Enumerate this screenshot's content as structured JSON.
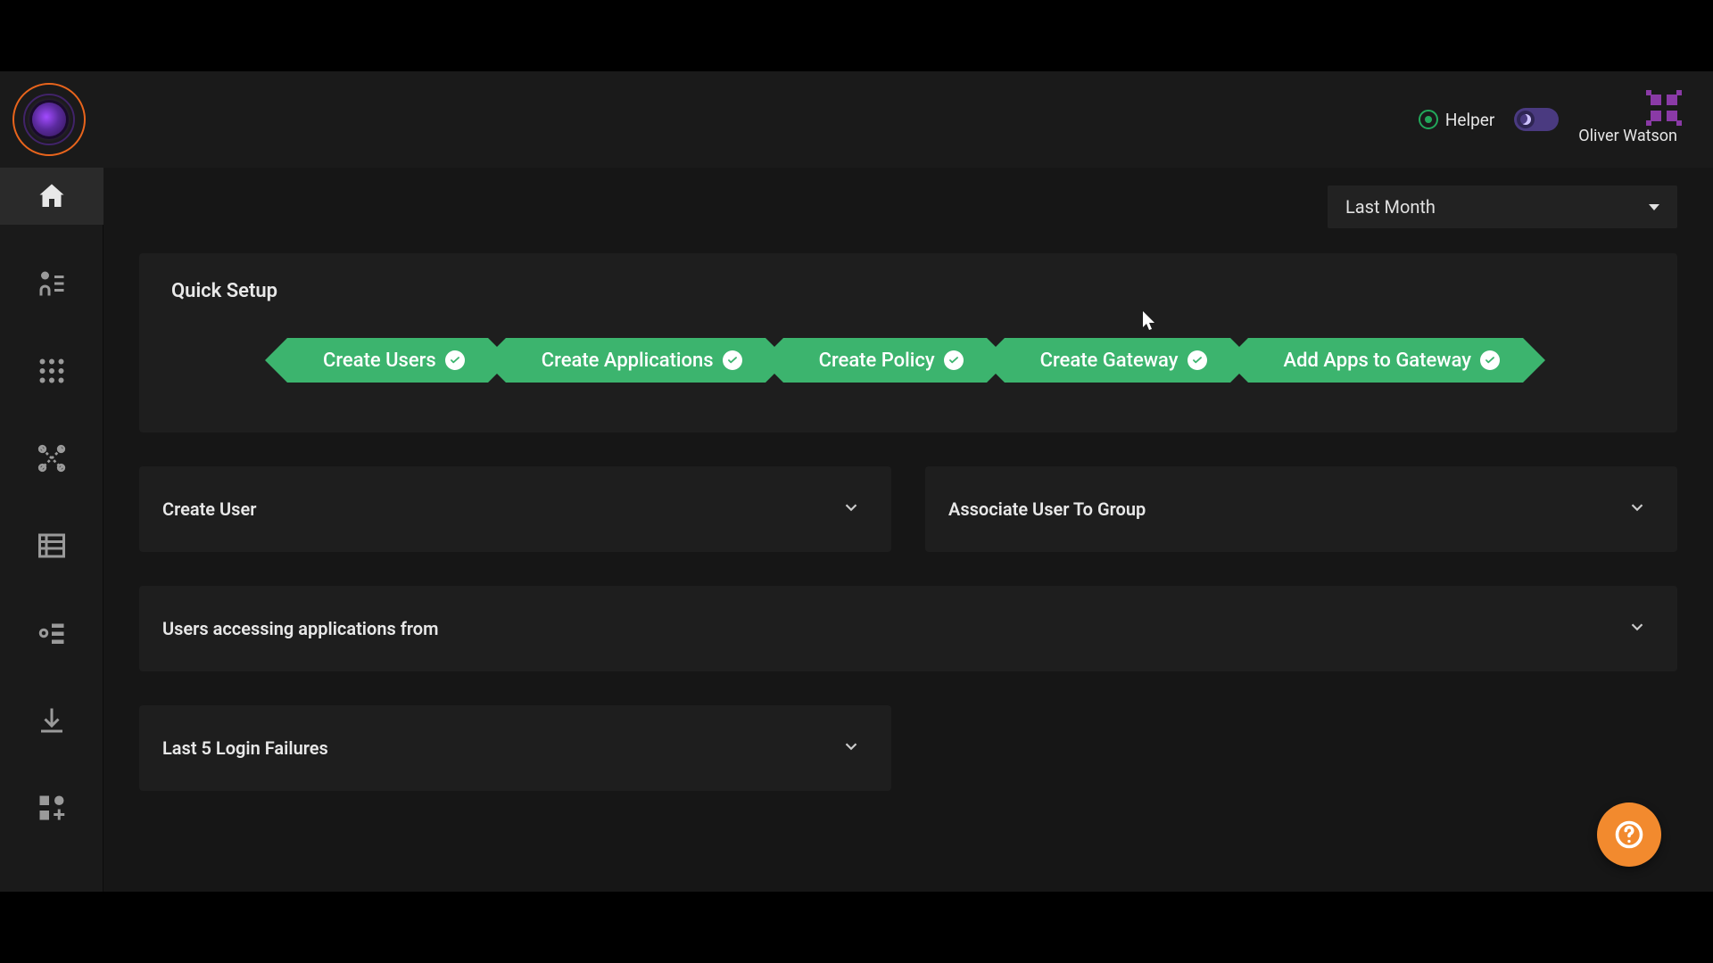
{
  "header": {
    "helper_label": "Helper",
    "user_name": "Oliver Watson"
  },
  "filter": {
    "selected": "Last Month"
  },
  "quick_setup": {
    "title": "Quick Setup",
    "steps": [
      {
        "label": "Create Users",
        "done": true
      },
      {
        "label": "Create Applications",
        "done": true
      },
      {
        "label": "Create Policy",
        "done": true
      },
      {
        "label": "Create Gateway",
        "done": true
      },
      {
        "label": "Add Apps to Gateway",
        "done": true
      }
    ]
  },
  "panels": {
    "create_user": "Create User",
    "associate_group": "Associate User To Group",
    "users_accessing": "Users accessing applications from",
    "login_failures": "Last 5 Login Failures"
  }
}
